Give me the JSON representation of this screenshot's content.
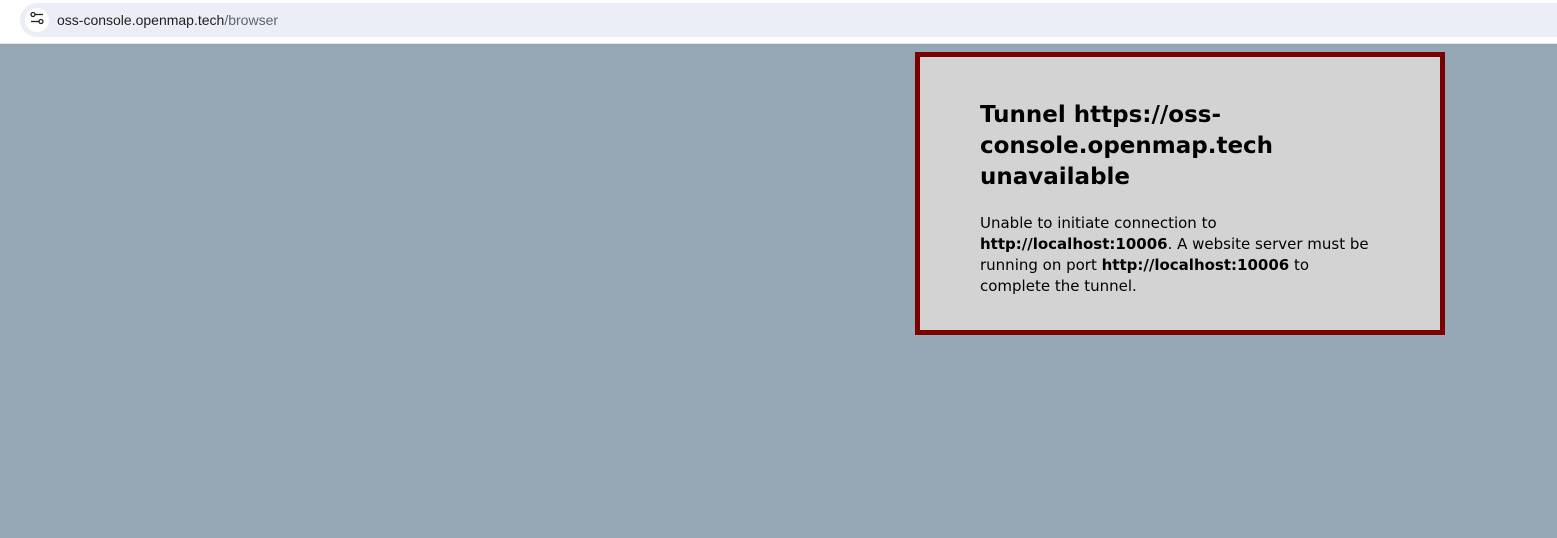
{
  "browser": {
    "url_host": "oss-console.openmap.tech",
    "url_path": "/browser",
    "site_info_icon": "tune-icon"
  },
  "error": {
    "title": "Tunnel https://oss-console.openmap.tech unavailable",
    "message_part1": "Unable to initiate connection to ",
    "message_bold1": "http://localhost:10006",
    "message_part2": ". A website server must be running on port ",
    "message_bold2": "http://localhost:10006",
    "message_part3": " to complete the tunnel."
  },
  "colors": {
    "page_background": "#96a7b5",
    "box_background": "#d3d3d3",
    "box_border": "#7d0000",
    "address_bar": "#ebeef6"
  }
}
